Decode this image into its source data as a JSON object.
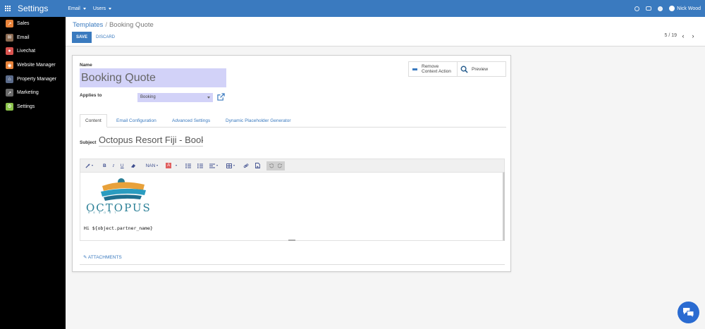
{
  "topbar": {
    "brand": "Settings",
    "menus": [
      "Email",
      "Users"
    ],
    "user_name": "Nick Wood"
  },
  "sidebar": {
    "items": [
      {
        "label": "Sales",
        "icon": "sales-icon",
        "color": "#e8833a"
      },
      {
        "label": "Email",
        "icon": "email-icon",
        "color": "#8a6a52"
      },
      {
        "label": "Livechat",
        "icon": "livechat-icon",
        "color": "#d9534f"
      },
      {
        "label": "Website Manager",
        "icon": "website-icon",
        "color": "#e8833a"
      },
      {
        "label": "Property Manager",
        "icon": "property-icon",
        "color": "#5b6b8a"
      },
      {
        "label": "Marketing",
        "icon": "marketing-icon",
        "color": "#6a6a6a"
      },
      {
        "label": "Settings",
        "icon": "settings-icon",
        "color": "#8bc34a"
      }
    ]
  },
  "breadcrumb": {
    "parent": "Templates",
    "separator": "/",
    "current": "Booking Quote"
  },
  "actions": {
    "save": "SAVE",
    "discard": "DISCARD"
  },
  "pager": {
    "value": "5 / 19",
    "prev": "‹",
    "next": "›"
  },
  "form": {
    "name_label": "Name",
    "name_value": "Booking Quote",
    "applies_to_label": "Applies to",
    "applies_to_value": "Booking",
    "remove_line1": "Remove",
    "remove_line2": "Context Action",
    "preview_label": "Preview",
    "tabs": [
      "Content",
      "Email Configuration",
      "Advanced Settings",
      "Dynamic Placeholder Generator"
    ],
    "subject_label": "Subject",
    "subject_value": "Octopus Resort Fiji - Booking Quote",
    "attachments_label": "ATTACHMENTS"
  },
  "editor": {
    "toolbar": {
      "bold": "B",
      "italic": "I",
      "underline": "U",
      "font_size": "NAN",
      "font_color": "A"
    },
    "logo_text": "OCTOPUS",
    "logo_subtext": "RESORT",
    "greeting": "Hi ${object.partner_name}"
  },
  "colors": {
    "accent": "#3a7abf",
    "sidebar_bg": "#000000",
    "required_field": "#d2d2f8",
    "chat_button": "#2a6bd1"
  }
}
